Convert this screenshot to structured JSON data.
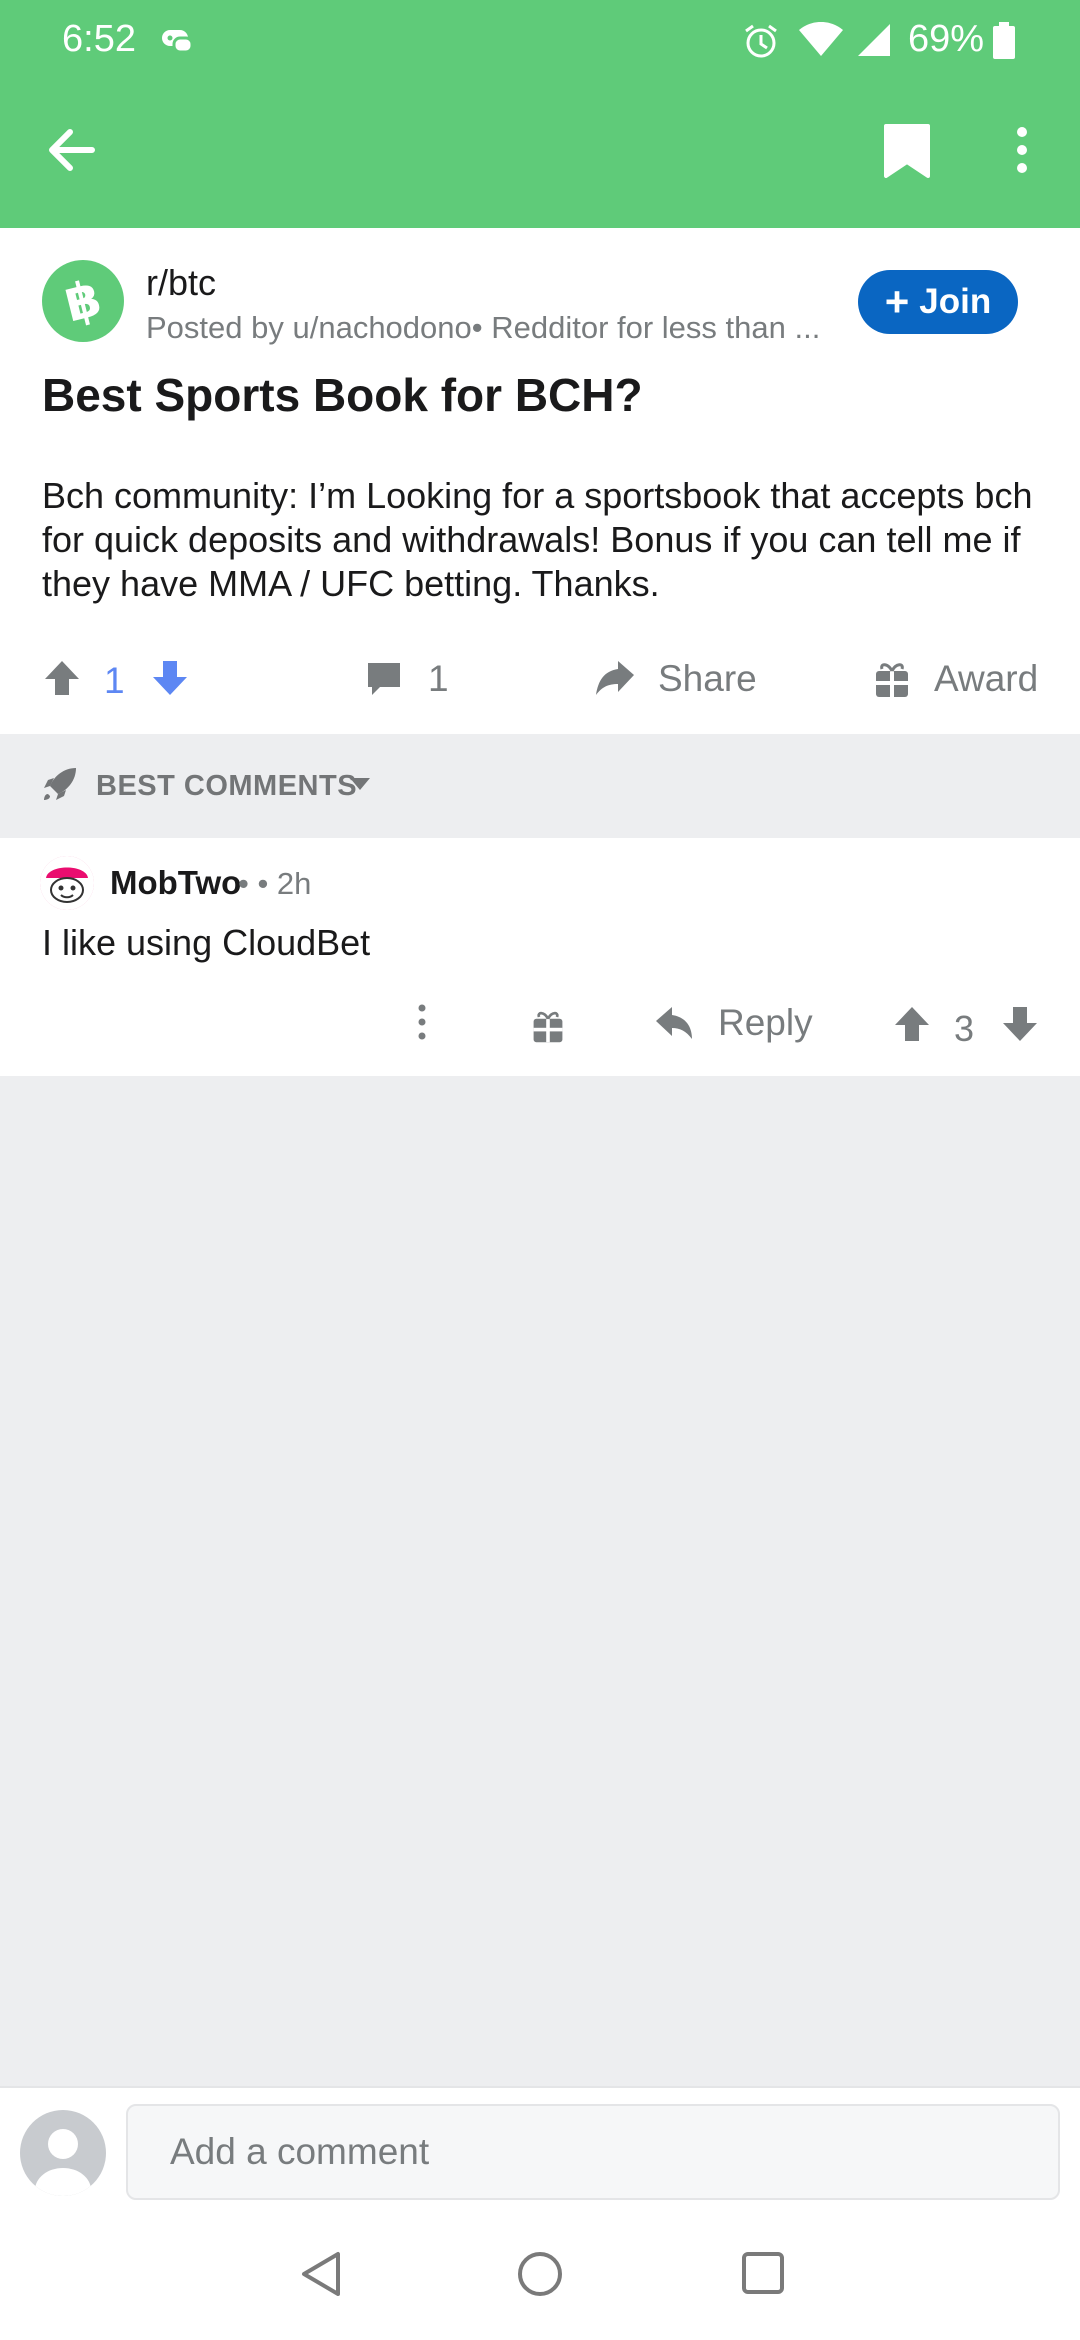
{
  "status_bar": {
    "time": "6:52",
    "battery": "69%"
  },
  "app_bar": {
    "back_icon": "arrow-left-icon",
    "bookmark_icon": "bookmark-icon",
    "more_icon": "more-vertical-icon"
  },
  "post": {
    "subreddit": "r/btc",
    "posted_by": "Posted by u/nachodono• Redditor for less than ...",
    "join_label": "Join",
    "title": "Best Sports Book for BCH?",
    "body": "Bch community:  I’m Looking for a sportsbook that accepts bch for quick deposits and withdrawals!  Bonus if you can tell me if they have  MMA / UFC betting. Thanks.",
    "vote_count": "1",
    "comment_count": "1",
    "share_label": "Share",
    "award_label": "Award"
  },
  "sort": {
    "label": "BEST COMMENTS"
  },
  "comments": [
    {
      "author": "MobTwo",
      "meta": "• • 2h",
      "text": "I like using CloudBet",
      "reply_label": "Reply",
      "score": "3"
    }
  ],
  "composer": {
    "placeholder": "Add a comment"
  },
  "colors": {
    "app_bar": "#5fcb79",
    "join_button": "#0a66c2",
    "upvoted_accent": "#5d87f3",
    "background_grey": "#edeef0"
  }
}
